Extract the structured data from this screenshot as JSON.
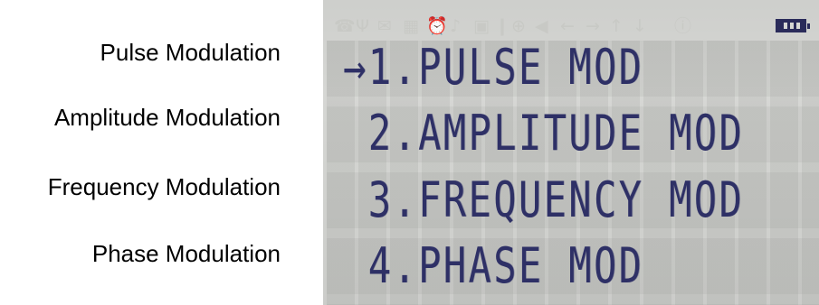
{
  "labels": [
    "Pulse Modulation",
    "Amplitude Modulation",
    "Frequency Modulation",
    "Phase Modulation"
  ],
  "lcd": {
    "cursor": "→",
    "menu": [
      "1.PULSE MOD",
      "2.AMPLITUDE MOD",
      "3.FREQUENCY MOD",
      "4.PHASE MOD"
    ],
    "selected_index": 0,
    "status_icons": [
      "phone-icon",
      "antenna-icon",
      "envelope-icon",
      "calendar-icon",
      "alarm-icon",
      "bell-icon",
      "disk-icon",
      "thermometer-icon",
      "globe-icon",
      "speaker-icon",
      "arrow-left-icon",
      "arrow-right-icon",
      "arrow-up-icon",
      "arrow-down-icon",
      "info-icon"
    ],
    "battery_icon": "battery-full-icon",
    "colors": {
      "lcd_background": "#d6d7d4",
      "pixel_on": "#2e3066"
    }
  }
}
